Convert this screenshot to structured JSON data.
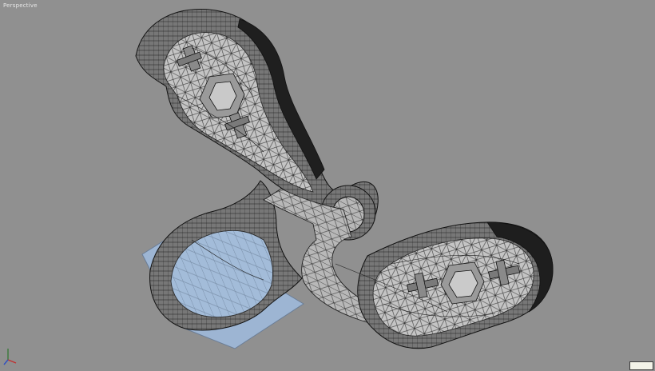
{
  "viewport": {
    "label": "Perspective",
    "corner_badge": "",
    "colors": {
      "background": "#909090",
      "wall_dark": "#2e2e2e",
      "wall_mid": "#6a6a6a",
      "floor": "#c2c2c2",
      "wire": "#1a1a1a",
      "selection": "#9cb4d4"
    },
    "icons": [
      "axis-gizmo-icon"
    ]
  }
}
